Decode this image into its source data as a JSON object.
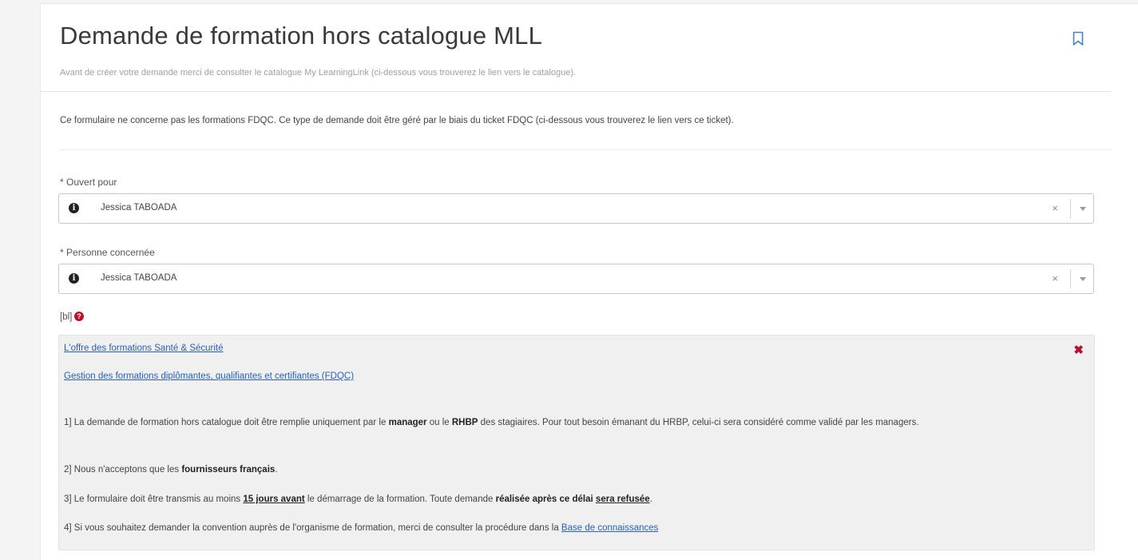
{
  "header": {
    "title": "Demande de formation hors catalogue MLL",
    "subtitle": "Avant de créer votre demande merci de consulter le catalogue My LearningLink (ci-dessous vous trouverez le lien vers le catalogue)."
  },
  "intro": "Ce formulaire ne concerne pas les formations FDQC. Ce type de demande doit être géré par le biais du ticket FDQC (ci-dessous vous trouverez le lien vers ce ticket).",
  "fields": {
    "opened_for": {
      "required_mark": "*",
      "label": "Ouvert pour",
      "value": "Jessica TABOADA"
    },
    "person_concerned": {
      "required_mark": "*",
      "label": "Personne concernée",
      "value": "Jessica TABOADA"
    }
  },
  "bl_label": "[bl]",
  "notice": {
    "link1": "L'offre des formations Santé & Sécurité",
    "link2": "Gestion des formations diplômantes, qualifiantes et certifiantes (FDQC)",
    "rule1": {
      "a": "1] La demande de formation hors catalogue doit être remplie uniquement par le ",
      "b1": "manager",
      "c": " ou le ",
      "b2": "RHBP",
      "d": " des stagiaires. Pour tout besoin émanant du HRBP, celui-ci sera considéré comme validé par les managers."
    },
    "rule2": {
      "a": "2] Nous n'acceptons que les ",
      "b": "fournisseurs français",
      "c": "."
    },
    "rule3": {
      "a": "3] Le formulaire doit être transmis au moins ",
      "b": "15 jours avant",
      "c": " le démarrage de la formation. Toute demande ",
      "d": "réalisée après ce délai",
      "e": " ",
      "f": "sera refusée",
      "g": "."
    },
    "rule4": {
      "a": "4] Si vous souhaitez demander la convention auprès de l'organisme de formation, merci de consulter la procédure dans la ",
      "link": "Base de connaissances"
    }
  },
  "icons": {
    "bookmark": "bookmark-icon",
    "info": "info-icon",
    "clear": "clear-icon",
    "dropdown": "chevron-down-icon",
    "help": "help-icon",
    "close": "close-icon"
  },
  "colors": {
    "link": "#2760b8",
    "danger": "#c0102b"
  }
}
